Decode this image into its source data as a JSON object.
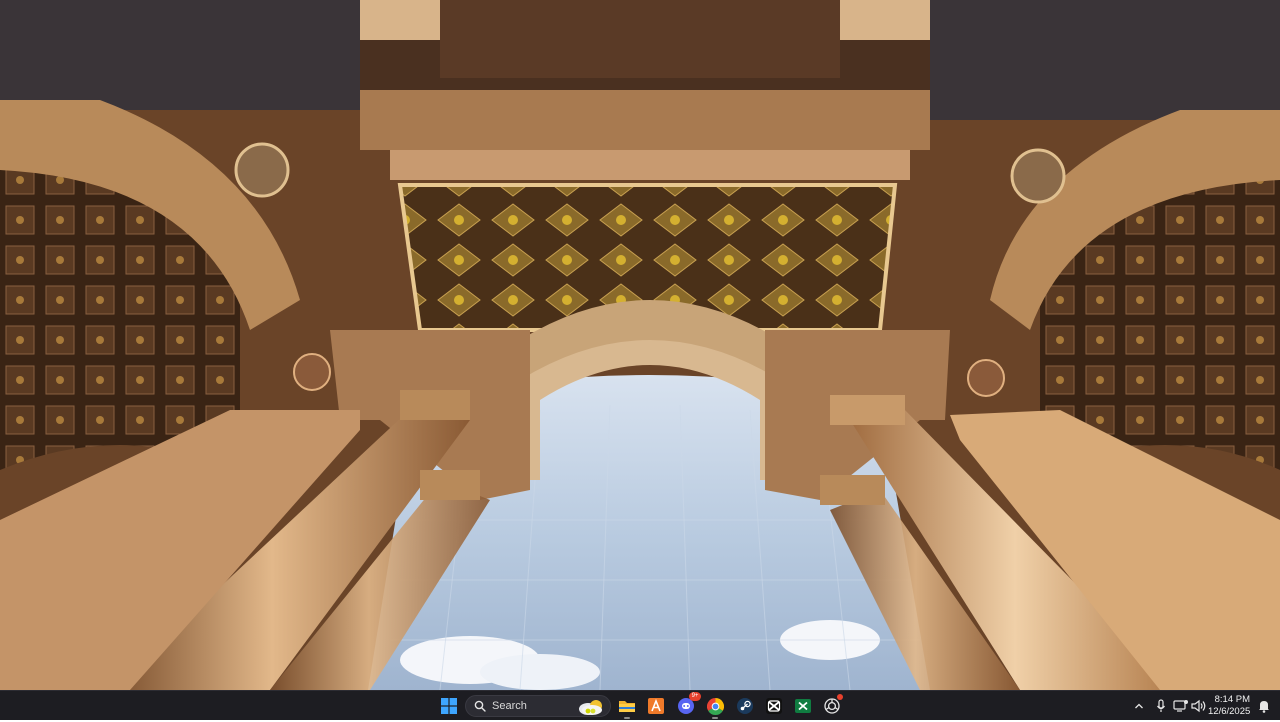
{
  "desktop": {
    "wallpaper": "Looking up through an ornate stone archway with coffered ceiling and columns toward the sky"
  },
  "taskbar": {
    "search": {
      "label": "Search"
    },
    "apps": [
      {
        "name": "windows-start",
        "icon": "windows-logo-icon"
      },
      {
        "name": "search",
        "icon": "search-icon"
      },
      {
        "name": "widgets",
        "icon": "weather-widget-icon"
      },
      {
        "name": "file-explorer",
        "icon": "folder-icon"
      },
      {
        "name": "app-a",
        "icon": "orange-a-app-icon"
      },
      {
        "name": "discord",
        "icon": "discord-icon",
        "badge": "9+"
      },
      {
        "name": "chrome",
        "icon": "chrome-icon"
      },
      {
        "name": "steam",
        "icon": "steam-icon"
      },
      {
        "name": "capcut",
        "icon": "capcut-icon"
      },
      {
        "name": "excel",
        "icon": "excel-icon"
      },
      {
        "name": "chatgpt",
        "icon": "chatgpt-icon"
      }
    ],
    "tray": {
      "icons": [
        "chevron-up-icon",
        "microphone-icon",
        "network-icon",
        "volume-icon",
        "notification-icon"
      ]
    },
    "clock": {
      "time": "8:14 PM",
      "date": "12/6/2025"
    }
  },
  "colors": {
    "taskbar_bg": "#1d1d22",
    "accent": "#0078d4"
  }
}
